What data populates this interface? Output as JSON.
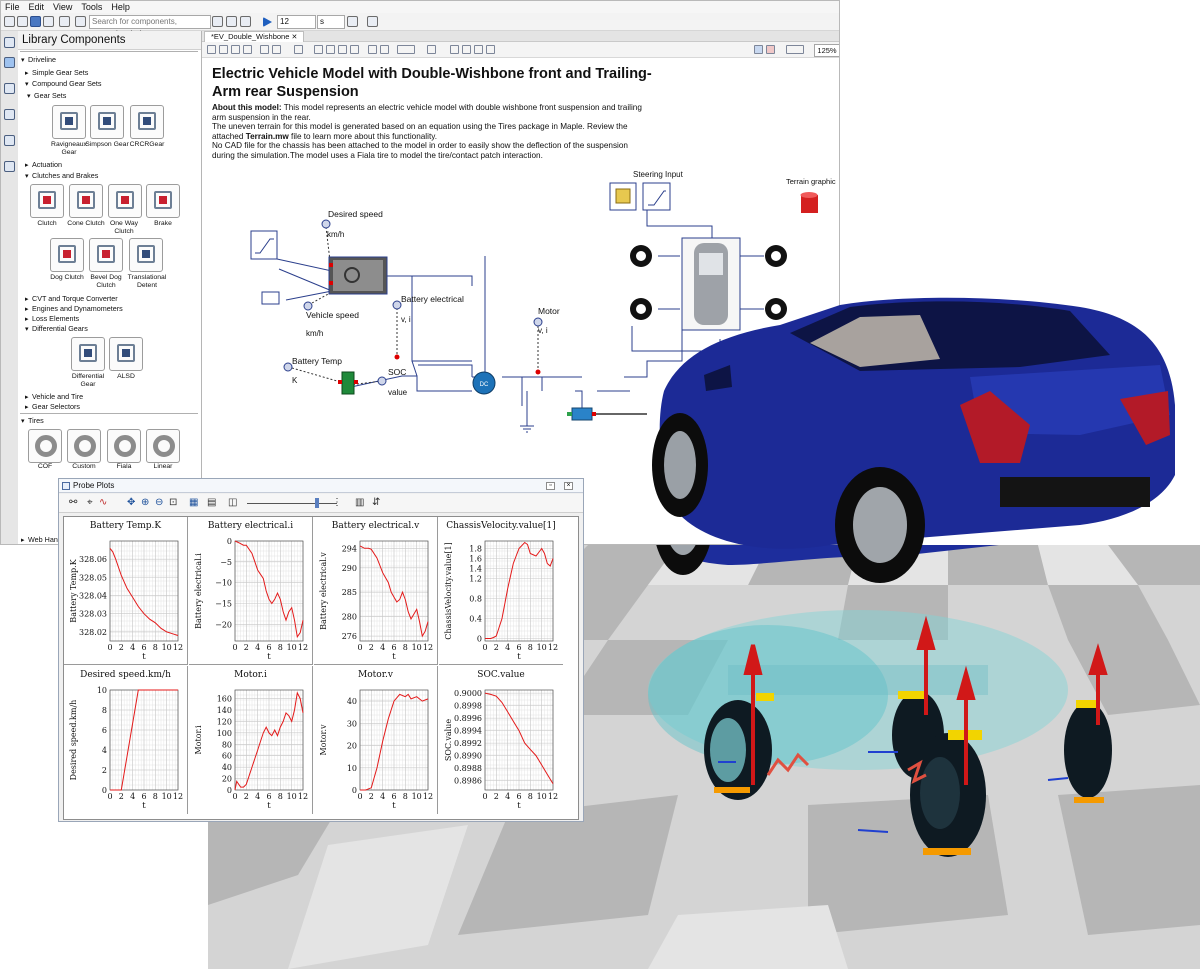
{
  "menu": [
    "File",
    "Edit",
    "View",
    "Tools",
    "Help"
  ],
  "toolbar": {
    "search_placeholder": "Search for components, examples, help...",
    "sim_time": "12",
    "sim_unit": "s"
  },
  "library": {
    "title": "Library Components",
    "tree": {
      "driveline": "Driveline",
      "simple_gear_sets": "Simple Gear Sets",
      "compound_gear_sets": "Compound Gear Sets",
      "gear_sets": "Gear Sets",
      "actuation": "Actuation",
      "clutches_and_brakes": "Clutches and Brakes",
      "cvt": "CVT and Torque Converter",
      "engines": "Engines and Dynamometers",
      "loss_elements": "Loss Elements",
      "differential_gears": "Differential Gears",
      "vehicle_and_tire": "Vehicle and Tire",
      "gear_selectors": "Gear Selectors",
      "tires": "Tires",
      "web_handling": "Web Handlin"
    },
    "gear_sets": [
      "Ravigneaux Gear",
      "Simpson Gear",
      "CRCRGear"
    ],
    "clutches": [
      "Clutch",
      "Cone Clutch",
      "One Way Clutch",
      "Brake",
      "Dog Clutch",
      "Bevel Dog Clutch",
      "Translational Detent"
    ],
    "differentials": [
      "Differential Gear",
      "ALSD"
    ],
    "tires": [
      "COF",
      "Custom",
      "Fiala",
      "Linear"
    ]
  },
  "document": {
    "tab_label": "*EV_Double_Wishbone",
    "zoom": "125%",
    "title": "Electric Vehicle Model with Double-Wishbone front and Trailing-Arm rear Suspension",
    "about_label": "About this model:",
    "about_text_1": " This  model represents an electric vehicle model with double wishbone front suspension and trailing arm suspension in the rear.",
    "about_text_2": "The uneven terrain for this model is generated based on an equation using the Tires package in Maple. Review the attached ",
    "about_file": "Terrain.mw",
    "about_text_3": " file to learn more about this functionality.",
    "about_text_4": "No CAD file for the chassis has been attached to the model in order to easily show the deflection of the suspension during the simulation.The model uses a Fiala tire to model the tire/contact patch interaction."
  },
  "diagram": {
    "desired_speed": "Desired speed",
    "desired_speed_unit": "km/h",
    "vehicle_speed": "Vehicle speed",
    "vehicle_speed_unit": "km/h",
    "battery_electrical": "Battery electrical",
    "battery_electrical_unit": "v, i",
    "motor": "Motor",
    "motor_unit": "v, i",
    "battery_temp": "Battery Temp",
    "battery_temp_unit": "K",
    "soc": "SOC",
    "soc_unit": "value",
    "steering_input": "Steering Input",
    "terrain_graphic": "Terrain graphic"
  },
  "probe_window": {
    "title": "Probe Plots"
  },
  "chart_data": [
    {
      "type": "line",
      "title": "Battery Temp.K",
      "ylabel": "Battery Temp.K",
      "xlabel": "t",
      "xlim": [
        0,
        12
      ],
      "ylim": [
        328.015,
        328.07
      ],
      "yticks": [
        328.02,
        328.03,
        328.04,
        328.05,
        328.06
      ],
      "yticklabels": [
        "328.02",
        "328.03",
        "328.04",
        "328.05",
        "328.06"
      ],
      "x": [
        0,
        0.5,
        1,
        2,
        3,
        4,
        5,
        6,
        7,
        8,
        9,
        10,
        11,
        12
      ],
      "y": [
        328.066,
        328.064,
        328.06,
        328.051,
        328.044,
        328.039,
        328.034,
        328.03,
        328.027,
        328.025,
        328.022,
        328.02,
        328.019,
        328.018
      ]
    },
    {
      "type": "line",
      "title": "Battery electrical.i",
      "ylabel": "Battery electrical.i",
      "xlabel": "t",
      "xlim": [
        0,
        12
      ],
      "ylim": [
        -24,
        0
      ],
      "yticks": [
        0,
        -5,
        -10,
        -15,
        -20
      ],
      "yticklabels": [
        "0",
        "−5",
        "−10",
        "−15",
        "−20"
      ],
      "x": [
        0,
        0.8,
        1.5,
        2,
        3,
        4,
        4.5,
        5,
        5.5,
        6,
        6.5,
        7,
        7.5,
        8,
        8.5,
        9,
        9.5,
        10,
        10.5,
        11,
        11.5,
        12
      ],
      "y": [
        0,
        -0.5,
        -1,
        -1,
        -3,
        -7,
        -8,
        -9,
        -12,
        -14,
        -15,
        -14,
        -12.5,
        -14,
        -17,
        -19,
        -17,
        -16,
        -19,
        -23,
        -22,
        -19
      ]
    },
    {
      "type": "line",
      "title": "Battery electrical.v",
      "ylabel": "Battery electrical.v",
      "xlabel": "t",
      "xlim": [
        0,
        12
      ],
      "ylim": [
        275,
        295.5
      ],
      "yticks": [
        276,
        280,
        285,
        290,
        294
      ],
      "yticklabels": [
        "276",
        "280",
        "285",
        "290",
        "294"
      ],
      "x": [
        0,
        0.8,
        1.5,
        2,
        3,
        4,
        4.5,
        5,
        5.5,
        6,
        6.5,
        7,
        7.5,
        8,
        8.5,
        9,
        9.5,
        10,
        10.5,
        11,
        11.5,
        12
      ],
      "y": [
        294.5,
        294,
        294,
        293.8,
        292,
        289,
        288,
        287,
        285,
        284,
        283,
        283.5,
        285,
        283.5,
        281,
        279.5,
        280.5,
        281.5,
        279,
        276,
        277,
        279
      ]
    },
    {
      "type": "line",
      "title": "ChassisVelocity.value[1]",
      "ylabel": "ChassisVelocity.value[1]",
      "xlabel": "t",
      "xlim": [
        0,
        12
      ],
      "ylim": [
        -0.05,
        1.95
      ],
      "yticks": [
        0,
        0.4,
        0.8,
        1.2,
        1.4,
        1.6,
        1.8
      ],
      "yticklabels": [
        "0",
        "0.4",
        "0.8",
        "1.2",
        "1.4",
        "1.6",
        "1.8"
      ],
      "x": [
        0,
        1,
        1.5,
        2,
        3,
        4,
        5,
        6,
        7,
        7.5,
        8,
        9,
        10,
        10.5,
        11,
        11.5,
        12
      ],
      "y": [
        0,
        0,
        0.02,
        0.05,
        0.4,
        1,
        1.5,
        1.8,
        1.92,
        1.88,
        1.7,
        1.65,
        1.8,
        1.7,
        1.5,
        1.45,
        1.6
      ]
    },
    {
      "type": "line",
      "title": "Desired speed.km/h",
      "ylabel": "Desired speed.km/h",
      "xlabel": "t",
      "xlim": [
        0,
        12
      ],
      "ylim": [
        0,
        10
      ],
      "yticks": [
        0,
        2,
        4,
        6,
        8,
        10
      ],
      "yticklabels": [
        "0",
        "2",
        "4",
        "6",
        "8",
        "10"
      ],
      "x": [
        0,
        1,
        2,
        5,
        6,
        12
      ],
      "y": [
        0,
        0,
        0,
        10,
        10,
        10
      ]
    },
    {
      "type": "line",
      "title": "Motor.i",
      "ylabel": "Motor.i",
      "xlabel": "t",
      "xlim": [
        0,
        12
      ],
      "ylim": [
        0,
        175
      ],
      "yticks": [
        0,
        20,
        40,
        60,
        80,
        100,
        120,
        140,
        160
      ],
      "yticklabels": [
        "0",
        "20",
        "40",
        "60",
        "80",
        "100",
        "120",
        "140",
        "160"
      ],
      "x": [
        0,
        0.3,
        1,
        1.5,
        2,
        3,
        4,
        4.5,
        5,
        5.5,
        6,
        6.5,
        7,
        7.5,
        8,
        8.5,
        9,
        9.5,
        10,
        10.5,
        11,
        11.5,
        12
      ],
      "y": [
        0,
        15,
        5,
        5,
        10,
        40,
        70,
        85,
        100,
        110,
        100,
        95,
        105,
        95,
        110,
        120,
        135,
        130,
        120,
        140,
        170,
        160,
        135
      ]
    },
    {
      "type": "line",
      "title": "Motor.v",
      "ylabel": "Motor.v",
      "xlabel": "t",
      "xlim": [
        0,
        12
      ],
      "ylim": [
        0,
        45
      ],
      "yticks": [
        0,
        10,
        20,
        30,
        40
      ],
      "yticklabels": [
        "0",
        "10",
        "20",
        "30",
        "40"
      ],
      "x": [
        0,
        1,
        2,
        3,
        4,
        5,
        6,
        7,
        8,
        8.5,
        9,
        10,
        11,
        12
      ],
      "y": [
        0,
        0,
        1,
        10,
        22,
        32,
        40,
        43,
        42,
        43,
        41,
        42,
        40,
        41
      ]
    },
    {
      "type": "line",
      "title": "SOC.value",
      "ylabel": "SOC.value",
      "xlabel": "t",
      "xlim": [
        0,
        12
      ],
      "ylim": [
        0.89845,
        0.90005
      ],
      "yticks": [
        0.8986,
        0.8988,
        0.899,
        0.8992,
        0.8994,
        0.8996,
        0.8998,
        0.9
      ],
      "yticklabels": [
        "0.8986",
        "0.8988",
        "0.8990",
        "0.8992",
        "0.8994",
        "0.8996",
        "0.8998",
        "0.9000"
      ],
      "x": [
        0,
        1,
        2,
        3,
        4,
        5,
        6,
        7,
        8,
        9,
        10,
        11,
        12
      ],
      "y": [
        0.9,
        0.89998,
        0.89995,
        0.89985,
        0.8997,
        0.89955,
        0.8994,
        0.8992,
        0.8991,
        0.899,
        0.89885,
        0.8987,
        0.89855
      ]
    }
  ],
  "x_ticks": [
    "0",
    "2",
    "4",
    "6",
    "8",
    "10",
    "12"
  ]
}
